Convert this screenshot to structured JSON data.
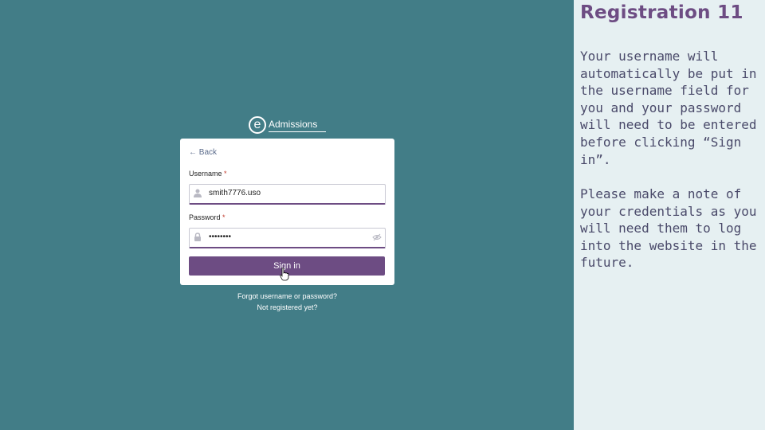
{
  "slide": {
    "title": "Registration 11",
    "paragraph1": "Your username will automatically be put in the username field for you and your password will need to be entered before clicking “Sign in”.",
    "paragraph2": "Please make a note of your credentials as you will need them to log into the website in the future."
  },
  "login": {
    "logo_letter": "e",
    "logo_text": "Admissions",
    "back_label": "← Back",
    "username_label": "Username",
    "password_label": "Password",
    "required_mark": "*",
    "username_value": "smith7776.uso",
    "password_value": "••••••••",
    "signin_label": "Sign in",
    "forgot_link": "Forgot username or password?",
    "register_link": "Not registered yet?"
  },
  "colors": {
    "stage_bg": "#427d87",
    "side_bg": "#e6f0f2",
    "accent": "#6d4c83"
  }
}
